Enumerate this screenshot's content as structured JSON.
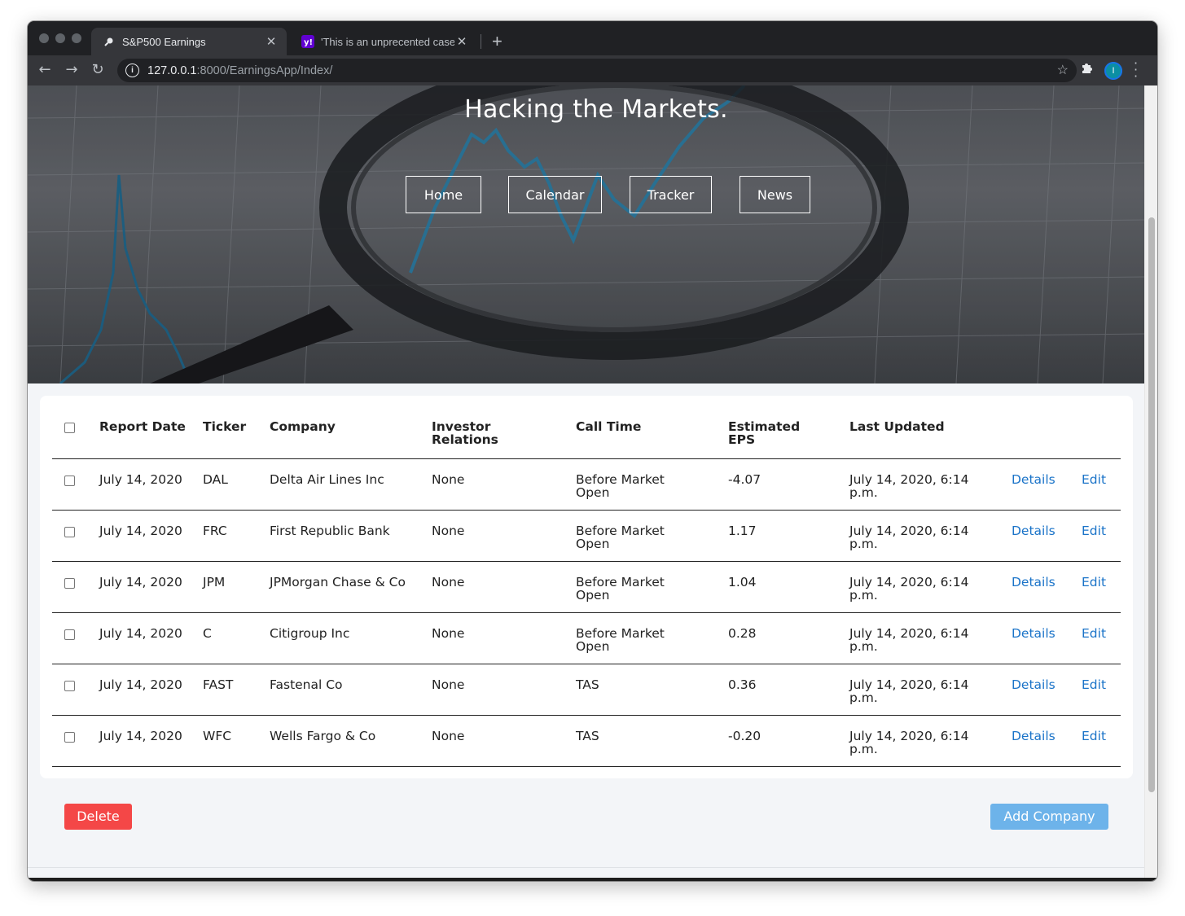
{
  "browser": {
    "tabs": [
      {
        "title": "S&P500 Earnings",
        "active": true
      },
      {
        "title": "'This is an unprecented case' W",
        "active": false
      }
    ],
    "new_tab_label": "+",
    "url_host": "127.0.0.1",
    "url_path": ":8000/EarningsApp/Index/",
    "profile_initial": "I"
  },
  "hero": {
    "title": "Hacking the Markets.",
    "nav": [
      "Home",
      "Calendar",
      "Tracker",
      "News"
    ]
  },
  "table": {
    "headers": [
      "Report Date",
      "Ticker",
      "Company",
      "Investor Relations",
      "Call Time",
      "Estimated EPS",
      "Last Updated"
    ],
    "rows": [
      {
        "date": "July 14, 2020",
        "ticker": "DAL",
        "company": "Delta Air Lines Inc",
        "ir": "None",
        "call_time": "Before Market Open",
        "eps": "-4.07",
        "updated": "July 14, 2020, 6:14 p.m.",
        "details": "Details",
        "edit": "Edit"
      },
      {
        "date": "July 14, 2020",
        "ticker": "FRC",
        "company": "First Republic Bank",
        "ir": "None",
        "call_time": "Before Market Open",
        "eps": "1.17",
        "updated": "July 14, 2020, 6:14 p.m.",
        "details": "Details",
        "edit": "Edit"
      },
      {
        "date": "July 14, 2020",
        "ticker": "JPM",
        "company": "JPMorgan Chase & Co",
        "ir": "None",
        "call_time": "Before Market Open",
        "eps": "1.04",
        "updated": "July 14, 2020, 6:14 p.m.",
        "details": "Details",
        "edit": "Edit"
      },
      {
        "date": "July 14, 2020",
        "ticker": "C",
        "company": "Citigroup Inc",
        "ir": "None",
        "call_time": "Before Market Open",
        "eps": "0.28",
        "updated": "July 14, 2020, 6:14 p.m.",
        "details": "Details",
        "edit": "Edit"
      },
      {
        "date": "July 14, 2020",
        "ticker": "FAST",
        "company": "Fastenal Co",
        "ir": "None",
        "call_time": "TAS",
        "eps": "0.36",
        "updated": "July 14, 2020, 6:14 p.m.",
        "details": "Details",
        "edit": "Edit"
      },
      {
        "date": "July 14, 2020",
        "ticker": "WFC",
        "company": "Wells Fargo & Co",
        "ir": "None",
        "call_time": "TAS",
        "eps": "-0.20",
        "updated": "July 14, 2020, 6:14 p.m.",
        "details": "Details",
        "edit": "Edit"
      }
    ]
  },
  "actions": {
    "delete_label": "Delete",
    "add_label": "Add Company"
  },
  "colors": {
    "delete": "#f44747",
    "add": "#6db3ea",
    "link": "#1a73c8"
  }
}
